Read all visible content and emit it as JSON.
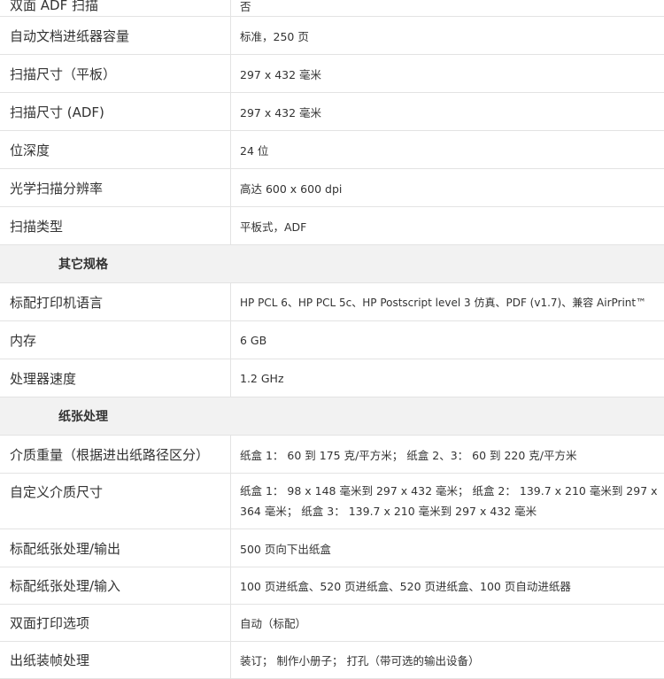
{
  "top_partial": {
    "label": "双面 ADF 扫描",
    "value": "否"
  },
  "scan_rows": [
    {
      "label": "自动文档进纸器容量",
      "value": "标准，250 页"
    },
    {
      "label": "扫描尺寸（平板）",
      "value": "297 x 432 毫米"
    },
    {
      "label": "扫描尺寸 (ADF)",
      "value": "297 x 432 毫米"
    },
    {
      "label": "位深度",
      "value": "24 位"
    },
    {
      "label": "光学扫描分辨率",
      "value": "高达 600 x 600 dpi"
    },
    {
      "label": "扫描类型",
      "value": "平板式，ADF"
    }
  ],
  "other_section": {
    "title": "其它规格"
  },
  "other_rows": [
    {
      "label": "标配打印机语言",
      "value": "HP PCL 6、HP PCL 5c、HP Postscript level 3 仿真、PDF (v1.7)、兼容 AirPrint™"
    },
    {
      "label": "内存",
      "value": "6 GB"
    },
    {
      "label": "处理器速度",
      "value": "1.2 GHz"
    }
  ],
  "paper_section": {
    "title": "纸张处理"
  },
  "paper_rows": [
    {
      "label": "介质重量（根据进出纸路径区分）",
      "value": "纸盒 1： 60 到 175 克/平方米； 纸盒 2、3： 60 到 220 克/平方米"
    },
    {
      "label": "自定义介质尺寸",
      "value": "纸盒 1： 98 x 148 毫米到 297 x 432 毫米； 纸盒 2： 139.7 x 210 毫米到 297 x 364 毫米； 纸盒 3： 139.7 x 210 毫米到 297 x 432 毫米"
    },
    {
      "label": "标配纸张处理/输出",
      "value": "500 页向下出纸盒"
    },
    {
      "label": "标配纸张处理/输入",
      "value": "100 页进纸盒、520 页进纸盒、520 页进纸盒、100 页自动进纸器"
    },
    {
      "label": "双面打印选项",
      "value": "自动（标配）"
    },
    {
      "label": "出纸装帧处理",
      "value": "装订； 制作小册子； 打孔（带可选的输出设备）"
    }
  ]
}
